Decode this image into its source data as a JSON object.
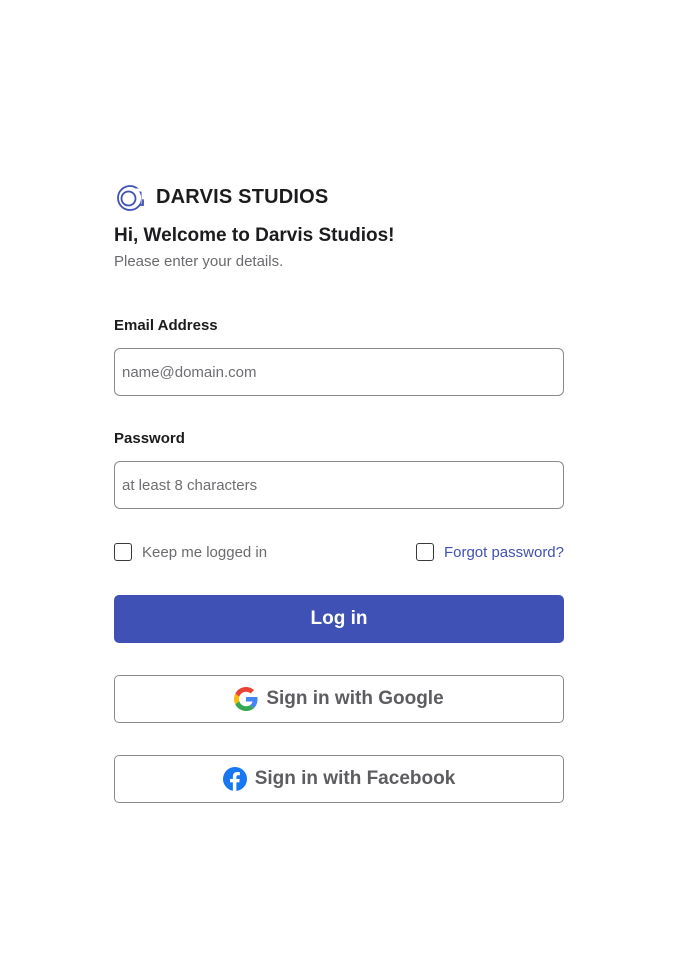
{
  "brand": {
    "name": "DARVIS STUDIOS",
    "icon": "darvis-logo-icon",
    "color": "#3f51b5"
  },
  "header": {
    "welcome": "Hi, Welcome to Darvis Studios!",
    "subtitle": "Please enter your details."
  },
  "form": {
    "email": {
      "label": "Email Address",
      "placeholder": "name@domain.com",
      "value": ""
    },
    "password": {
      "label": "Password",
      "placeholder": "at least 8 characters",
      "value": ""
    },
    "keep_logged_in": {
      "label": "Keep me logged in",
      "checked": false
    },
    "forgot_password": {
      "label": "Forgot password?",
      "checked": false
    },
    "login_label": "Log in"
  },
  "social": {
    "google_label": "Sign in with Google",
    "google_icon": "google-icon",
    "facebook_label": "Sign in with Facebook",
    "facebook_icon": "facebook-icon"
  },
  "colors": {
    "accent": "#3f51b5",
    "facebook": "#1877f2",
    "google_blue": "#4285f4",
    "google_red": "#ea4335",
    "google_yellow": "#fbbc05",
    "google_green": "#34a853"
  }
}
